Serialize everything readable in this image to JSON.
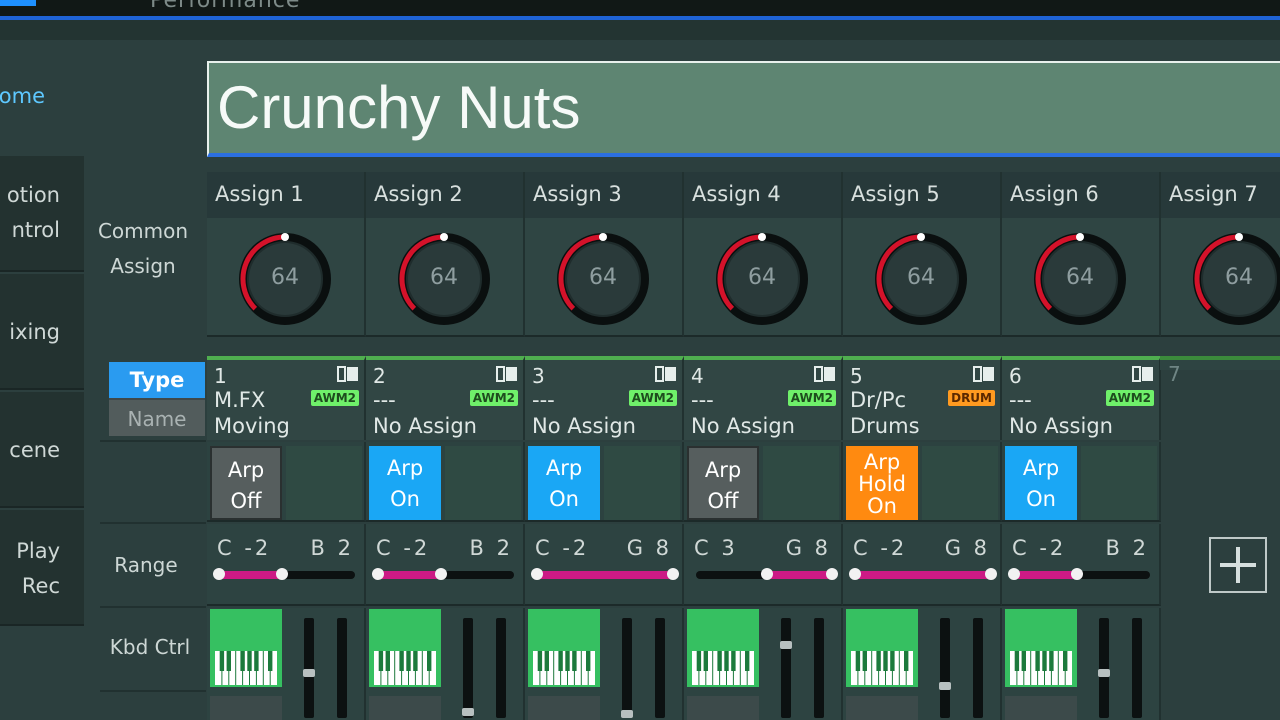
{
  "header": {
    "title": "Performance"
  },
  "sidebar": {
    "home": "Home",
    "items": [
      {
        "label": "Motion\nControl",
        "visible": "otion\nntrol"
      },
      {
        "label": "Mixing",
        "visible": "ixing"
      },
      {
        "label": "Scene",
        "visible": "cene"
      },
      {
        "label": "Play\nRec",
        "visible": "Play\n Rec"
      }
    ]
  },
  "performance": {
    "name": "Crunchy Nuts"
  },
  "labels": {
    "common_assign": "Common\nAssign",
    "type": "Type",
    "name": "Name",
    "range": "Range",
    "kbd_ctrl": "Kbd Ctrl"
  },
  "assign_knobs": [
    {
      "label": "Assign 1",
      "value": "64"
    },
    {
      "label": "Assign 2",
      "value": "64"
    },
    {
      "label": "Assign 3",
      "value": "64"
    },
    {
      "label": "Assign 4",
      "value": "64"
    },
    {
      "label": "Assign 5",
      "value": "64"
    },
    {
      "label": "Assign 6",
      "value": "64"
    },
    {
      "label": "Assign 7",
      "value": "64"
    }
  ],
  "parts": [
    {
      "num": "1",
      "type": "M.FX",
      "name": "Moving",
      "badge": "AWM2",
      "arp": "Arp\nOff",
      "arp_state": "off",
      "range_low": "C -2",
      "range_high": "B 2",
      "range_fraction": [
        0,
        0.46
      ],
      "fader_level": 0.45
    },
    {
      "num": "2",
      "type": "---",
      "name": "No Assign",
      "badge": "AWM2",
      "arp": "Arp\nOn",
      "arp_state": "on",
      "range_low": "C -2",
      "range_high": "B 2",
      "range_fraction": [
        0,
        0.46
      ],
      "fader_level": 0.02
    },
    {
      "num": "3",
      "type": "---",
      "name": "No Assign",
      "badge": "AWM2",
      "arp": "Arp\nOn",
      "arp_state": "on",
      "range_low": "C -2",
      "range_high": "G 8",
      "range_fraction": [
        0,
        1
      ],
      "fader_level": 0.0
    },
    {
      "num": "4",
      "type": "---",
      "name": "No Assign",
      "badge": "AWM2",
      "arp": "Arp\nOff",
      "arp_state": "off",
      "range_low": "C 3",
      "range_high": "G 8",
      "range_fraction": [
        0.52,
        1
      ],
      "fader_level": 0.75
    },
    {
      "num": "5",
      "type": "Dr/Pc",
      "name": "Drums",
      "badge": "DRUM",
      "arp": "Arp\nHold\nOn",
      "arp_state": "hold",
      "range_low": "C -2",
      "range_high": "G 8",
      "range_fraction": [
        0,
        1
      ],
      "fader_level": 0.3
    },
    {
      "num": "6",
      "type": "---",
      "name": "No Assign",
      "badge": "AWM2",
      "arp": "Arp\nOn",
      "arp_state": "on",
      "range_low": "C -2",
      "range_high": "B 2",
      "range_fraction": [
        0,
        0.46
      ],
      "fader_level": 0.45
    }
  ],
  "part7": {
    "num": "7"
  },
  "colors": {
    "arp_on": "#1aa7f5",
    "arp_off": "#565e5e",
    "arp_hold": "#ff8a10",
    "knob_ring": "#d4122a",
    "kbd_green": "#36c061",
    "range_fill": "#cc1a85"
  }
}
